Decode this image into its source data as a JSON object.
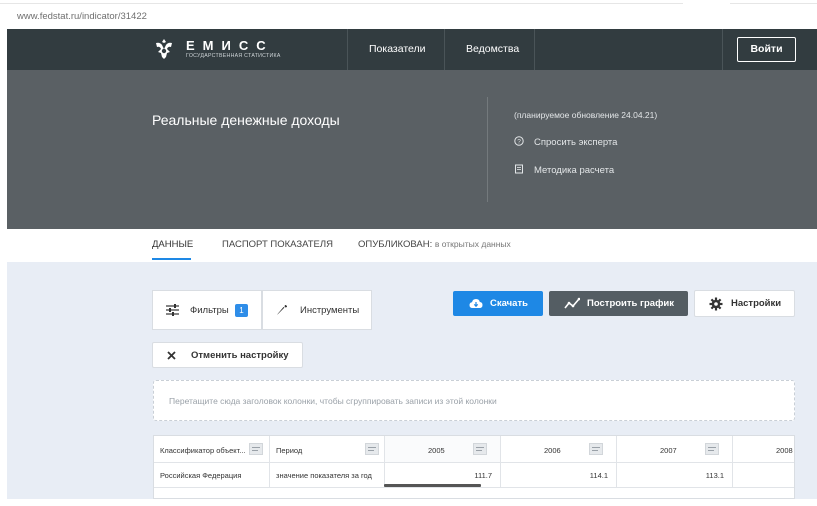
{
  "browser": {
    "url": "www.fedstat.ru/indicator/31422"
  },
  "header": {
    "logo_title": "ЕМИСС",
    "logo_subtitle": "государственная статистика",
    "nav": [
      "Показатели",
      "Ведомства"
    ],
    "login_label": "Войти"
  },
  "hero": {
    "title": "Реальные денежные доходы",
    "update_note": "(планируемое обновление 24.04.21)",
    "ask_expert": "Спросить эксперта",
    "methodology": "Методика расчета"
  },
  "tabs": {
    "data": "ДАННЫЕ",
    "passport": "ПАСПОРТ ПОКАЗАТЕЛЯ",
    "published_label": "ОПУБЛИКОВАН:",
    "published_value": "в открытых данных"
  },
  "toolbar": {
    "filters_label": "Фильтры",
    "filters_count": "1",
    "tools_label": "Инструменты",
    "download_label": "Скачать",
    "chart_label": "Построить график",
    "settings_label": "Настройки",
    "reset_label": "Отменить настройку"
  },
  "dropzone": {
    "text": "Перетащите сюда заголовок колонки, чтобы сгруппировать записи из этой колонки"
  },
  "grid": {
    "columns": [
      "Классификатор объект...",
      "Период",
      "2005",
      "2006",
      "2007",
      "2008"
    ],
    "rows": [
      {
        "classifier": "Российская Федерация",
        "period": "значение показателя за год",
        "values": [
          "111.7",
          "114.1",
          "113.1",
          ""
        ]
      }
    ]
  },
  "colors": {
    "header_bg": "#323c40",
    "hero_bg": "#5a6064",
    "accent": "#1e88e5",
    "content_bg": "#e8edf5"
  }
}
